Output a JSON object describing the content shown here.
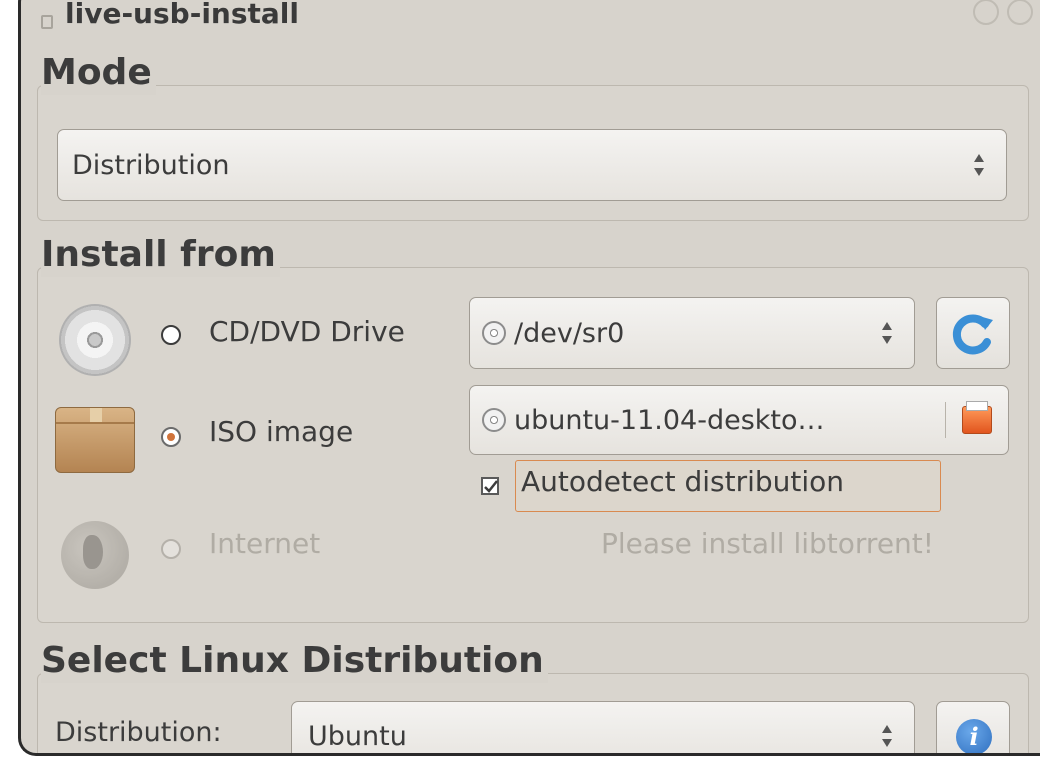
{
  "window": {
    "title": "live-usb-install"
  },
  "mode": {
    "title": "Mode",
    "selected": "Distribution"
  },
  "install_from": {
    "title": "Install from",
    "cd": {
      "label": "CD/DVD Drive",
      "device": "/dev/sr0"
    },
    "iso": {
      "label": "ISO image",
      "file": "ubuntu-11.04-deskto…",
      "autodetect_label": "Autodetect distribution"
    },
    "internet": {
      "label": "Internet",
      "message": "Please install libtorrent!"
    }
  },
  "select_distro": {
    "title": "Select Linux Distribution",
    "label": "Distribution:",
    "selected": "Ubuntu"
  },
  "colors": {
    "window_bg": "#d7d3cc",
    "accent_orange": "#d0733a",
    "refresh_blue": "#3a8fd6",
    "info_blue": "#2f6fbf"
  }
}
